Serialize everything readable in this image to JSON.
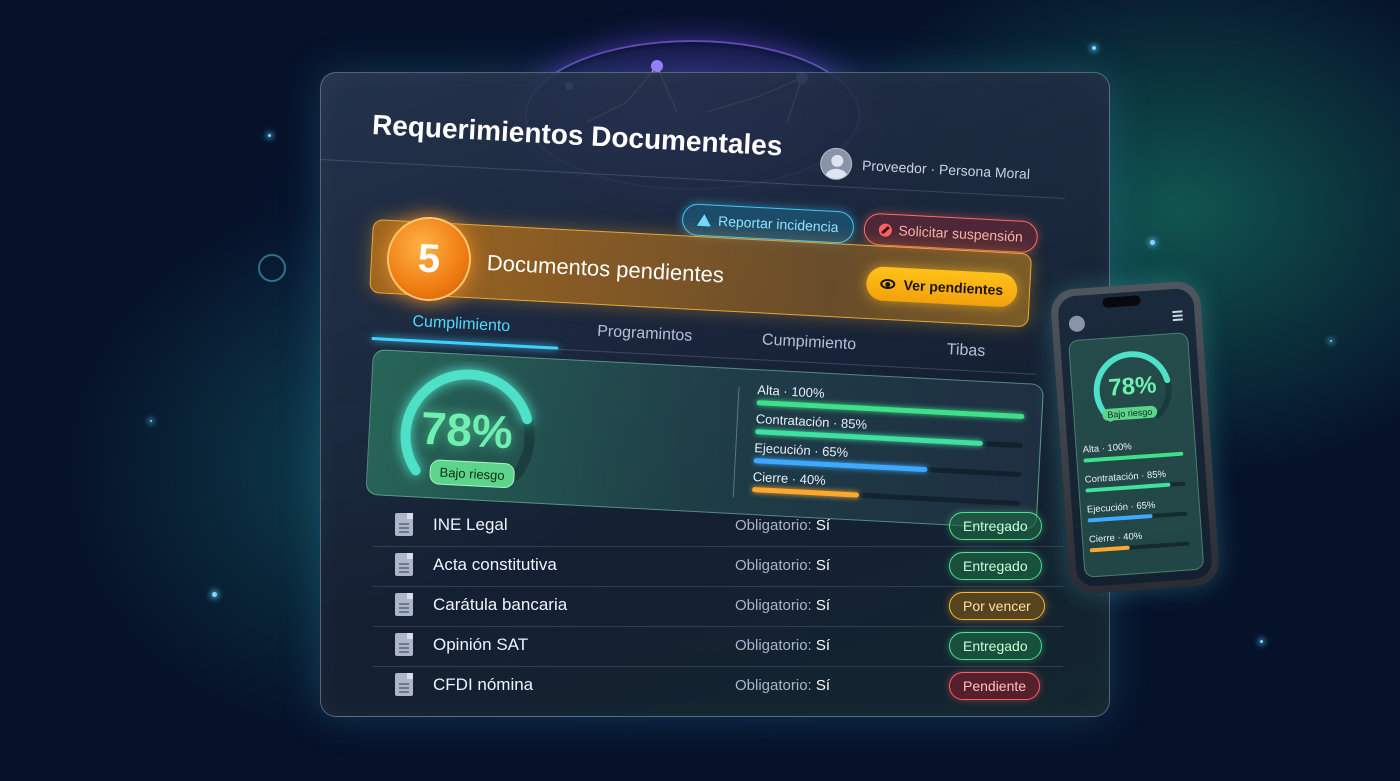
{
  "header": {
    "title": "Requerimientos Documentales",
    "user_label": "Proveedor · Persona Moral"
  },
  "actions": {
    "report_label": "Reportar incidencia",
    "suspend_label": "Solicitar suspensión"
  },
  "pending": {
    "count": "5",
    "label": "Documentos pendientes",
    "view_label": "Ver pendientes"
  },
  "tabs": [
    {
      "label": "Cumplimiento",
      "active": true
    },
    {
      "label": "Programintos",
      "active": false
    },
    {
      "label": "Cumpimiento",
      "active": false
    },
    {
      "label": "Tibas",
      "active": false
    }
  ],
  "compliance": {
    "percent_label": "78%",
    "percent_value": 0.78,
    "risk_label": "Bajo riesgo",
    "metrics": [
      {
        "label": "Alta · 100%",
        "value": 1.0,
        "color": "#3fe08a"
      },
      {
        "label": "Contratación · 85%",
        "value": 0.85,
        "color": "#3fe0a0"
      },
      {
        "label": "Ejecución · 65%",
        "value": 0.65,
        "color": "#3fa8ff"
      },
      {
        "label": "Cierre · 40%",
        "value": 0.4,
        "color": "#ffa82e"
      }
    ]
  },
  "documents": [
    {
      "name": "INE Legal",
      "req_label": "Obligatorio:",
      "req_value": "Sí",
      "status": "Entregado",
      "status_kind": "ok"
    },
    {
      "name": "Acta constitutiva",
      "req_label": "Obligatorio:",
      "req_value": "Sí",
      "status": "Entregado",
      "status_kind": "ok"
    },
    {
      "name": "Carátula bancaria",
      "req_label": "Obligatorio:",
      "req_value": "Sí",
      "status": "Por vencer",
      "status_kind": "warn"
    },
    {
      "name": "Opinión SAT",
      "req_label": "Obligatorio:",
      "req_value": "Sí",
      "status": "Entregado",
      "status_kind": "ok"
    },
    {
      "name": "CFDI nómina",
      "req_label": "Obligatorio:",
      "req_value": "Sí",
      "status": "Pendiente",
      "status_kind": "bad"
    }
  ],
  "mobile": {
    "percent_label": "78%",
    "risk_label": "Bajo riesgo",
    "metrics": [
      {
        "label": "Alta · 100%",
        "value": 1.0,
        "color": "#3fe08a"
      },
      {
        "label": "Contratación · 85%",
        "value": 0.85,
        "color": "#3fe0a0"
      },
      {
        "label": "Ejecución · 65%",
        "value": 0.65,
        "color": "#3fa8ff"
      },
      {
        "label": "Cierre · 40%",
        "value": 0.4,
        "color": "#ffa82e"
      }
    ]
  },
  "colors": {
    "accent": "#3ed0ff",
    "gauge": "#4fe0c8",
    "ok": "#4fe08c",
    "warn": "#ffb530",
    "bad": "#ff5b64"
  }
}
